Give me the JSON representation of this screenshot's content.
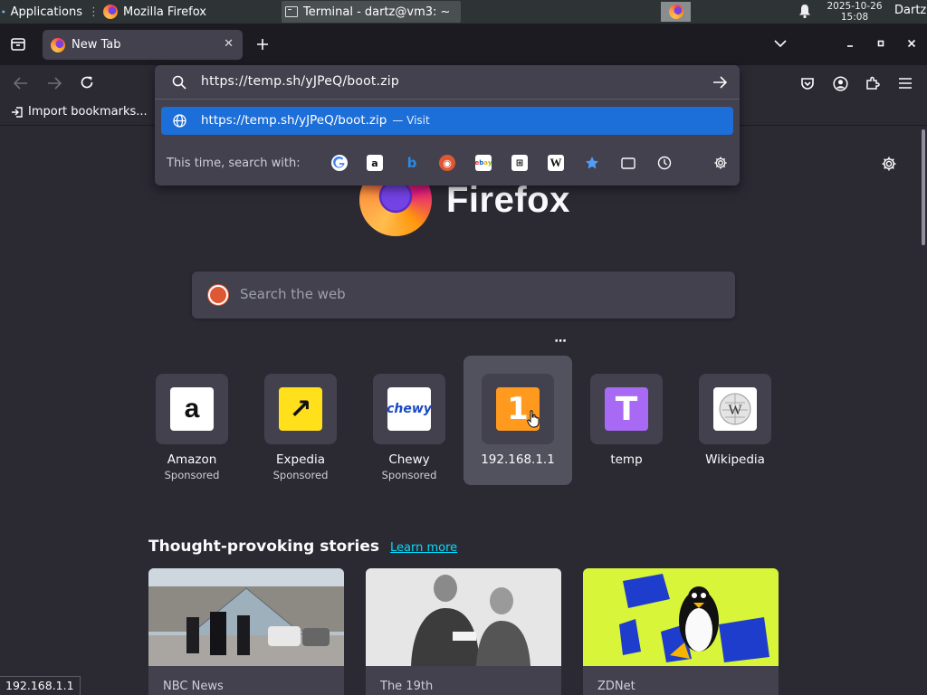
{
  "taskbar": {
    "apps_label": "Applications",
    "firefox_window": "Mozilla Firefox",
    "terminal_window": "Terminal - dartz@vm3: ~",
    "clock_date": "2025-10-26",
    "clock_time": "15:08",
    "user": "Dartz"
  },
  "tab": {
    "title": "New Tab",
    "close": "✕"
  },
  "bookmarks": {
    "import_label": "Import bookmarks..."
  },
  "urlbar": {
    "value": "https://temp.sh/yJPeQ/boot.zip",
    "suggestion_url": "https://temp.sh/yJPeQ/boot.zip",
    "suggestion_action": "— Visit",
    "oneoff_label": "This time, search with:",
    "engines": [
      "google-icon",
      "amazon-icon",
      "bing-icon",
      "duckduckgo-icon",
      "ebay-icon",
      "custom-engine-icon",
      "wikipedia-icon",
      "bookmarks-icon",
      "tabs-icon",
      "history-icon"
    ]
  },
  "ntp": {
    "brand": "Firefox",
    "search_placeholder": "Search the web",
    "shortcuts": [
      {
        "title": "Amazon",
        "sub": "Sponsored",
        "glyph": "a"
      },
      {
        "title": "Expedia",
        "sub": "Sponsored",
        "glyph": "↗"
      },
      {
        "title": "Chewy",
        "sub": "Sponsored",
        "glyph": "chewy"
      },
      {
        "title": "192.168.1.1",
        "sub": "",
        "glyph": "1"
      },
      {
        "title": "temp",
        "sub": "",
        "glyph": "T"
      },
      {
        "title": "Wikipedia",
        "sub": "",
        "glyph": "W"
      }
    ],
    "stories_heading": "Thought-provoking stories",
    "learn_more": "Learn more",
    "stories": [
      {
        "source": "NBC News"
      },
      {
        "source": "The 19th"
      },
      {
        "source": "ZDNet"
      }
    ]
  },
  "status": {
    "link_url": "192.168.1.1"
  },
  "colors": {
    "accent": "#1c6ed8",
    "panel": "#42414d",
    "background": "#2b2a33",
    "link": "#00ddff"
  }
}
